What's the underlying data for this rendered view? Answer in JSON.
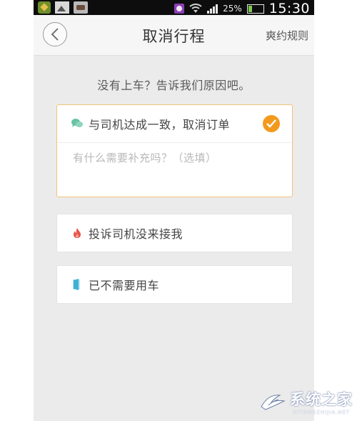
{
  "status_bar": {
    "battery_percent": "25%",
    "time": "15:30"
  },
  "header": {
    "title": "取消行程",
    "rules_link": "爽约规则"
  },
  "prompt": "没有上车？告诉我们原因吧。",
  "options": [
    {
      "label": "与司机达成一致，取消订单",
      "icon": "chat-bubble-icon",
      "selected": true
    },
    {
      "label": "投诉司机没来接我",
      "icon": "flame-icon",
      "selected": false
    },
    {
      "label": "已不需要用车",
      "icon": "door-icon",
      "selected": false
    }
  ],
  "note_field": {
    "placeholder": "有什么需要补充吗？（选填）",
    "value": ""
  },
  "colors": {
    "accent": "#f39a1e",
    "selected_border": "#f3c27a",
    "background": "#ebebeb",
    "chat_icon": "#67c3a5",
    "flame_icon": "#e8534a",
    "door_icon": "#3fb1d6"
  },
  "watermark": {
    "text_cn": "系统之家",
    "text_en": "XITONGZHIJIA.NET"
  }
}
